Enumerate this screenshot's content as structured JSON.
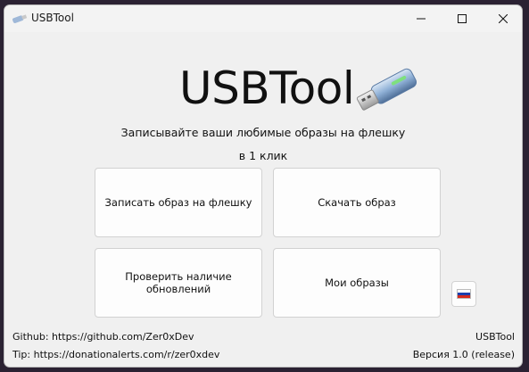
{
  "window": {
    "title": "USBTool",
    "controls": {
      "minimize_icon": "minimize-icon",
      "maximize_icon": "maximize-icon",
      "close_icon": "close-icon"
    }
  },
  "hero": {
    "title": "USBTool",
    "image_icon": "usb-flash-drive-icon"
  },
  "tagline": {
    "line1": "Записывайте ваши любимые образы на флешку",
    "line2": "в 1 клик"
  },
  "actions": {
    "write_image": "Записать образ на флешку",
    "download_image": "Скачать образ",
    "check_updates": "Проверить наличие обновлений",
    "my_images": "Мои образы"
  },
  "language": {
    "flag_icon": "russia-flag-icon",
    "colors": [
      "#ffffff",
      "#1c3fae",
      "#d52b1e"
    ]
  },
  "footer": {
    "github": "Github: https://github.com/Zer0xDev",
    "tip": "Tip: https://donationalerts.com/r/zer0xdev",
    "app_name": "USBTool",
    "version": "Версия 1.0 (release)"
  }
}
